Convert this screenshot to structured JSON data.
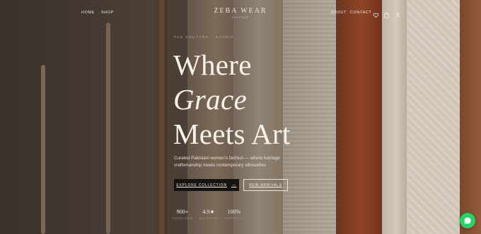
{
  "brand": {
    "name": "ZEBA WEAR",
    "tagline": "COUTURE"
  },
  "nav": {
    "left": [
      {
        "label": "HOME"
      },
      {
        "label": "SHOP"
      }
    ],
    "right": [
      {
        "label": "ABOUT"
      },
      {
        "label": "CONTACT"
      }
    ],
    "icons": [
      "heart-icon",
      "bag-icon",
      "user-icon"
    ]
  },
  "hero": {
    "eyebrow": "PAK COUTURE · STUDIO",
    "headline": [
      "Where",
      "Grace",
      "Meets Art"
    ],
    "subtitle": "Curated Pakistani women's fashion — where heritage craftsmanship meets contemporary silhouettes",
    "primary_cta": "EXPLORE COLLECTION",
    "secondary_cta": "NEW ARRIVALS",
    "stats": [
      {
        "value": "900+",
        "label": "PIECES SOLD"
      },
      {
        "value": "4.9★",
        "label": "AVG RATING"
      },
      {
        "value": "100%",
        "label": "AUTHENTIC"
      }
    ]
  },
  "colors": {
    "text": "#f7f2ea",
    "button_dark": "#171310",
    "chat": "#25d366"
  }
}
